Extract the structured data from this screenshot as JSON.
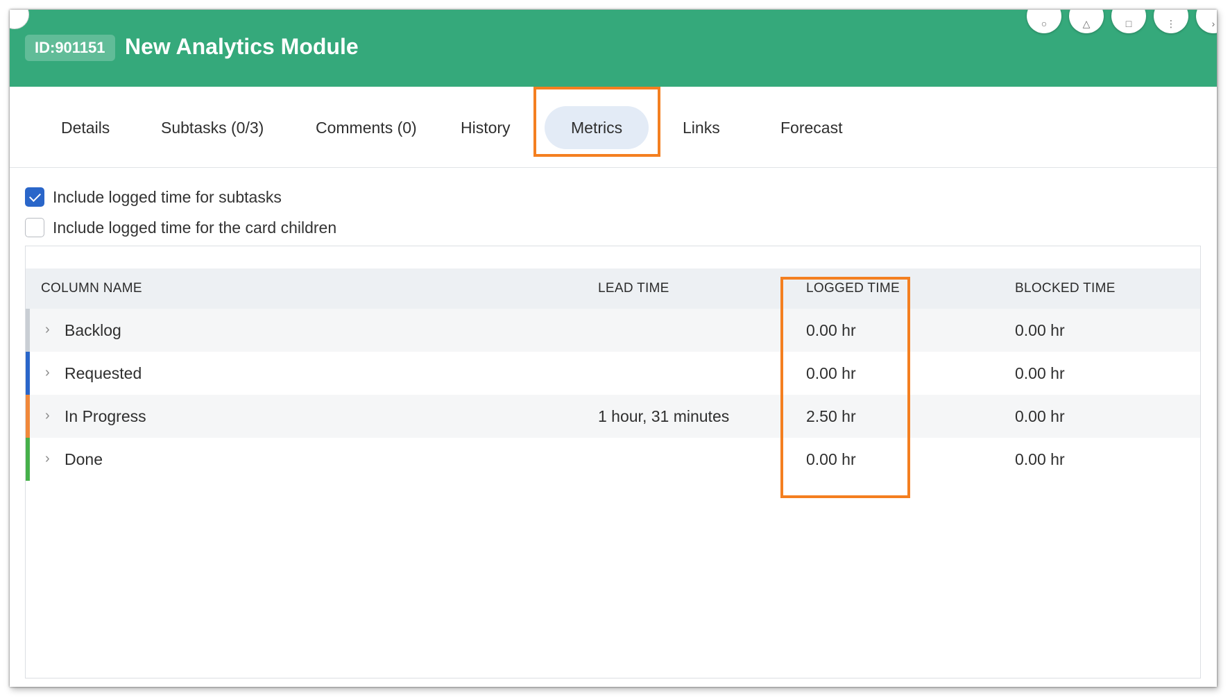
{
  "header": {
    "id_badge": "ID:901151",
    "title": "New Analytics Module",
    "accent_color": "#35a97b",
    "action_icons": [
      "comment-icon",
      "person-icon",
      "board-icon",
      "more-icon",
      "chevron-icon"
    ]
  },
  "tabs": [
    {
      "label": "Details"
    },
    {
      "label": "Subtasks (0/3)"
    },
    {
      "label": "Comments (0)"
    },
    {
      "label": "History"
    },
    {
      "label": "Metrics",
      "active": true
    },
    {
      "label": "Links"
    },
    {
      "label": "Forecast"
    }
  ],
  "options": [
    {
      "label": "Include logged time for subtasks",
      "checked": true
    },
    {
      "label": "Include logged time for the card children",
      "checked": false
    }
  ],
  "table": {
    "headers": [
      "COLUMN NAME",
      "LEAD TIME",
      "LOGGED TIME",
      "BLOCKED TIME"
    ],
    "rows": [
      {
        "name": "Backlog",
        "lead_time": "",
        "logged_time": "0.00 hr",
        "blocked_time": "0.00 hr",
        "color": "#c9ced4"
      },
      {
        "name": "Requested",
        "lead_time": "",
        "logged_time": "0.00 hr",
        "blocked_time": "0.00 hr",
        "color": "#2a66c9"
      },
      {
        "name": "In Progress",
        "lead_time": "1 hour, 31 minutes",
        "logged_time": "2.50 hr",
        "blocked_time": "0.00 hr",
        "color": "#f0883a"
      },
      {
        "name": "Done",
        "lead_time": "",
        "logged_time": "0.00 hr",
        "blocked_time": "0.00 hr",
        "color": "#46b04a"
      }
    ]
  },
  "highlight_color": "#f47f20"
}
